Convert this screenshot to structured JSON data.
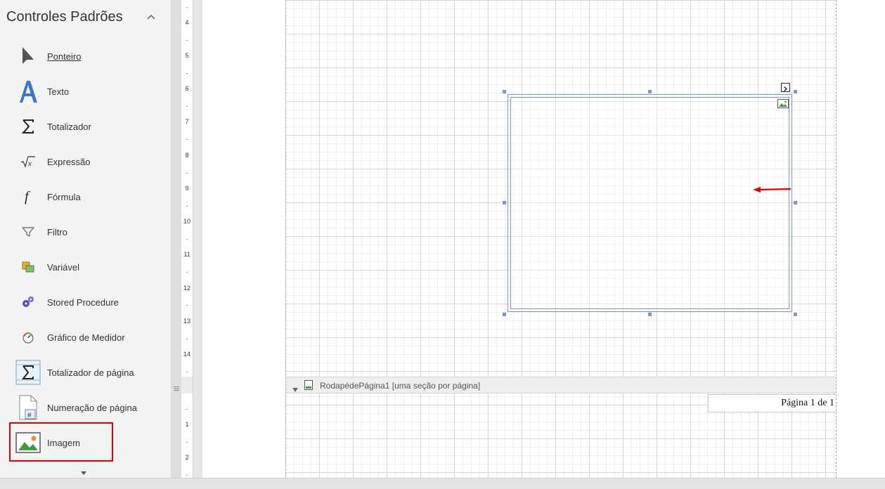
{
  "toolbox": {
    "title": "Controles Padrões",
    "collapse_icon": "chevron-up-icon",
    "items": [
      {
        "label": "Ponteiro",
        "icon": "pointer-icon"
      },
      {
        "label": "Texto",
        "icon": "text-a-icon"
      },
      {
        "label": "Totalizador",
        "icon": "sigma-icon"
      },
      {
        "label": "Expressão",
        "icon": "sqrt-x-icon"
      },
      {
        "label": "Fórmula",
        "icon": "function-f-icon"
      },
      {
        "label": "Filtro",
        "icon": "funnel-icon"
      },
      {
        "label": "Variável",
        "icon": "variable-icon"
      },
      {
        "label": "Stored Procedure",
        "icon": "gears-icon"
      },
      {
        "label": "Gráfico de Medidor",
        "icon": "gauge-icon"
      },
      {
        "label": "Totalizador de página",
        "icon": "page-sigma-icon"
      },
      {
        "label": "Numeração de página",
        "icon": "page-number-icon"
      },
      {
        "label": "Imagem",
        "icon": "image-icon"
      }
    ],
    "more_icon": "chevron-down-icon"
  },
  "ruler": {
    "top_numbers": [
      "4",
      "5",
      "6",
      "7",
      "8",
      "9",
      "10",
      "11",
      "12",
      "13",
      "14"
    ],
    "bottom_numbers": [
      "1",
      "2"
    ]
  },
  "designer": {
    "image_control_icon": "image-icon",
    "smart_tag_glyph": ">",
    "footer_section": {
      "label": "RodapédePágina1 [uma seção por página]"
    },
    "page_number_text": "Página 1 de 1"
  },
  "colors": {
    "selection_highlight": "#e00000",
    "control_border": "#7c96c4",
    "annotation_arrow": "#e00000"
  }
}
